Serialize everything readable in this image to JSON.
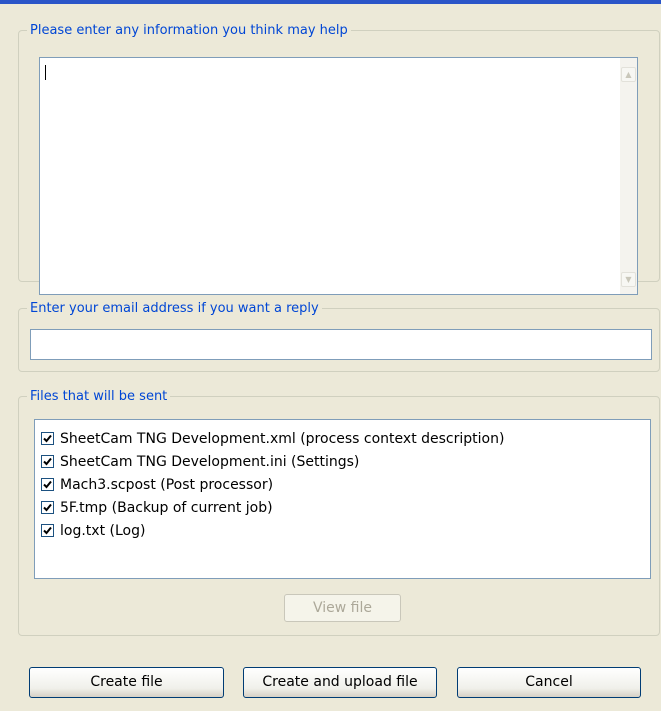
{
  "info_section": {
    "legend": "Please enter any information you think may help",
    "text_value": ""
  },
  "email_section": {
    "legend": "Enter your email address if you want a reply",
    "value": ""
  },
  "files_section": {
    "legend": "Files that will be sent",
    "files": [
      {
        "label": "SheetCam TNG Development.xml (process context description)",
        "checked": true
      },
      {
        "label": "SheetCam TNG Development.ini (Settings)",
        "checked": true
      },
      {
        "label": "Mach3.scpost (Post processor)",
        "checked": true
      },
      {
        "label": "5F.tmp (Backup of current job)",
        "checked": true
      },
      {
        "label": "log.txt (Log)",
        "checked": true
      }
    ],
    "view_file_label": "View file"
  },
  "buttons": {
    "create_file": "Create file",
    "create_upload": "Create and upload file",
    "cancel": "Cancel"
  },
  "icons": {
    "checkbox": "checkmark-icon",
    "scroll_up": "scroll-up-arrow-icon",
    "scroll_down": "scroll-down-arrow-icon"
  },
  "colors": {
    "legend_text": "#0046d5",
    "dialog_background": "#ece9d8",
    "input_border": "#7f9db9",
    "window_frame": "#2a55c8"
  }
}
